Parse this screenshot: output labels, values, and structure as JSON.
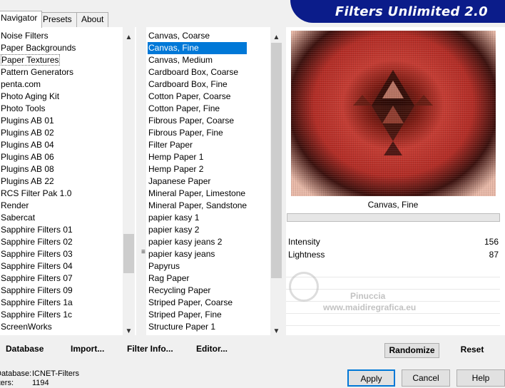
{
  "tabs": [
    "Navigator",
    "Presets",
    "About"
  ],
  "banner_title": "Filters Unlimited 2.0",
  "categories": {
    "items": [
      "Noise Filters",
      "Paper Backgrounds",
      "Paper Textures",
      "Pattern Generators",
      "penta.com",
      "Photo Aging Kit",
      "Photo Tools",
      "Plugins AB 01",
      "Plugins AB 02",
      "Plugins AB 04",
      "Plugins AB 06",
      "Plugins AB 08",
      "Plugins AB 22",
      "RCS Filter Pak 1.0",
      "Render",
      "Sabercat",
      "Sapphire Filters 01",
      "Sapphire Filters 02",
      "Sapphire Filters 03",
      "Sapphire Filters 04",
      "Sapphire Filters 07",
      "Sapphire Filters 09",
      "Sapphire Filters 1a",
      "Sapphire Filters 1c",
      "ScreenWorks"
    ],
    "selected": "Paper Textures"
  },
  "filters": {
    "items": [
      "Canvas, Coarse",
      "Canvas, Fine",
      "Canvas, Medium",
      "Cardboard Box, Coarse",
      "Cardboard Box, Fine",
      "Cotton Paper, Coarse",
      "Cotton Paper, Fine",
      "Fibrous Paper, Coarse",
      "Fibrous Paper, Fine",
      "Filter Paper",
      "Hemp Paper 1",
      "Hemp Paper 2",
      "Japanese Paper",
      "Mineral Paper, Limestone",
      "Mineral Paper, Sandstone",
      "papier kasy 1",
      "papier kasy 2",
      "papier kasy jeans 2",
      "papier kasy jeans",
      "Papyrus",
      "Rag Paper",
      "Recycling Paper",
      "Striped Paper, Coarse",
      "Striped Paper, Fine",
      "Structure Paper 1"
    ],
    "selected": "Canvas, Fine"
  },
  "preview": {
    "filter_name": "Canvas, Fine"
  },
  "params": [
    {
      "label": "Intensity",
      "value": "156"
    },
    {
      "label": "Lightness",
      "value": "87"
    }
  ],
  "watermark": {
    "name": "Pinuccia",
    "site": "www.maidiregrafica.eu"
  },
  "actions": {
    "database": "Database",
    "import": "Import...",
    "filter_info": "Filter Info...",
    "editor": "Editor..."
  },
  "controls": {
    "randomize": "Randomize",
    "reset": "Reset"
  },
  "info": {
    "database_label": "Database:",
    "database_value": "ICNET-Filters",
    "filters_label": "Filters:",
    "filters_value": "1194"
  },
  "buttons": {
    "apply": "Apply",
    "cancel": "Cancel",
    "help": "Help"
  },
  "colors": {
    "accent": "#0078d7",
    "banner": "#0b1c8a"
  }
}
